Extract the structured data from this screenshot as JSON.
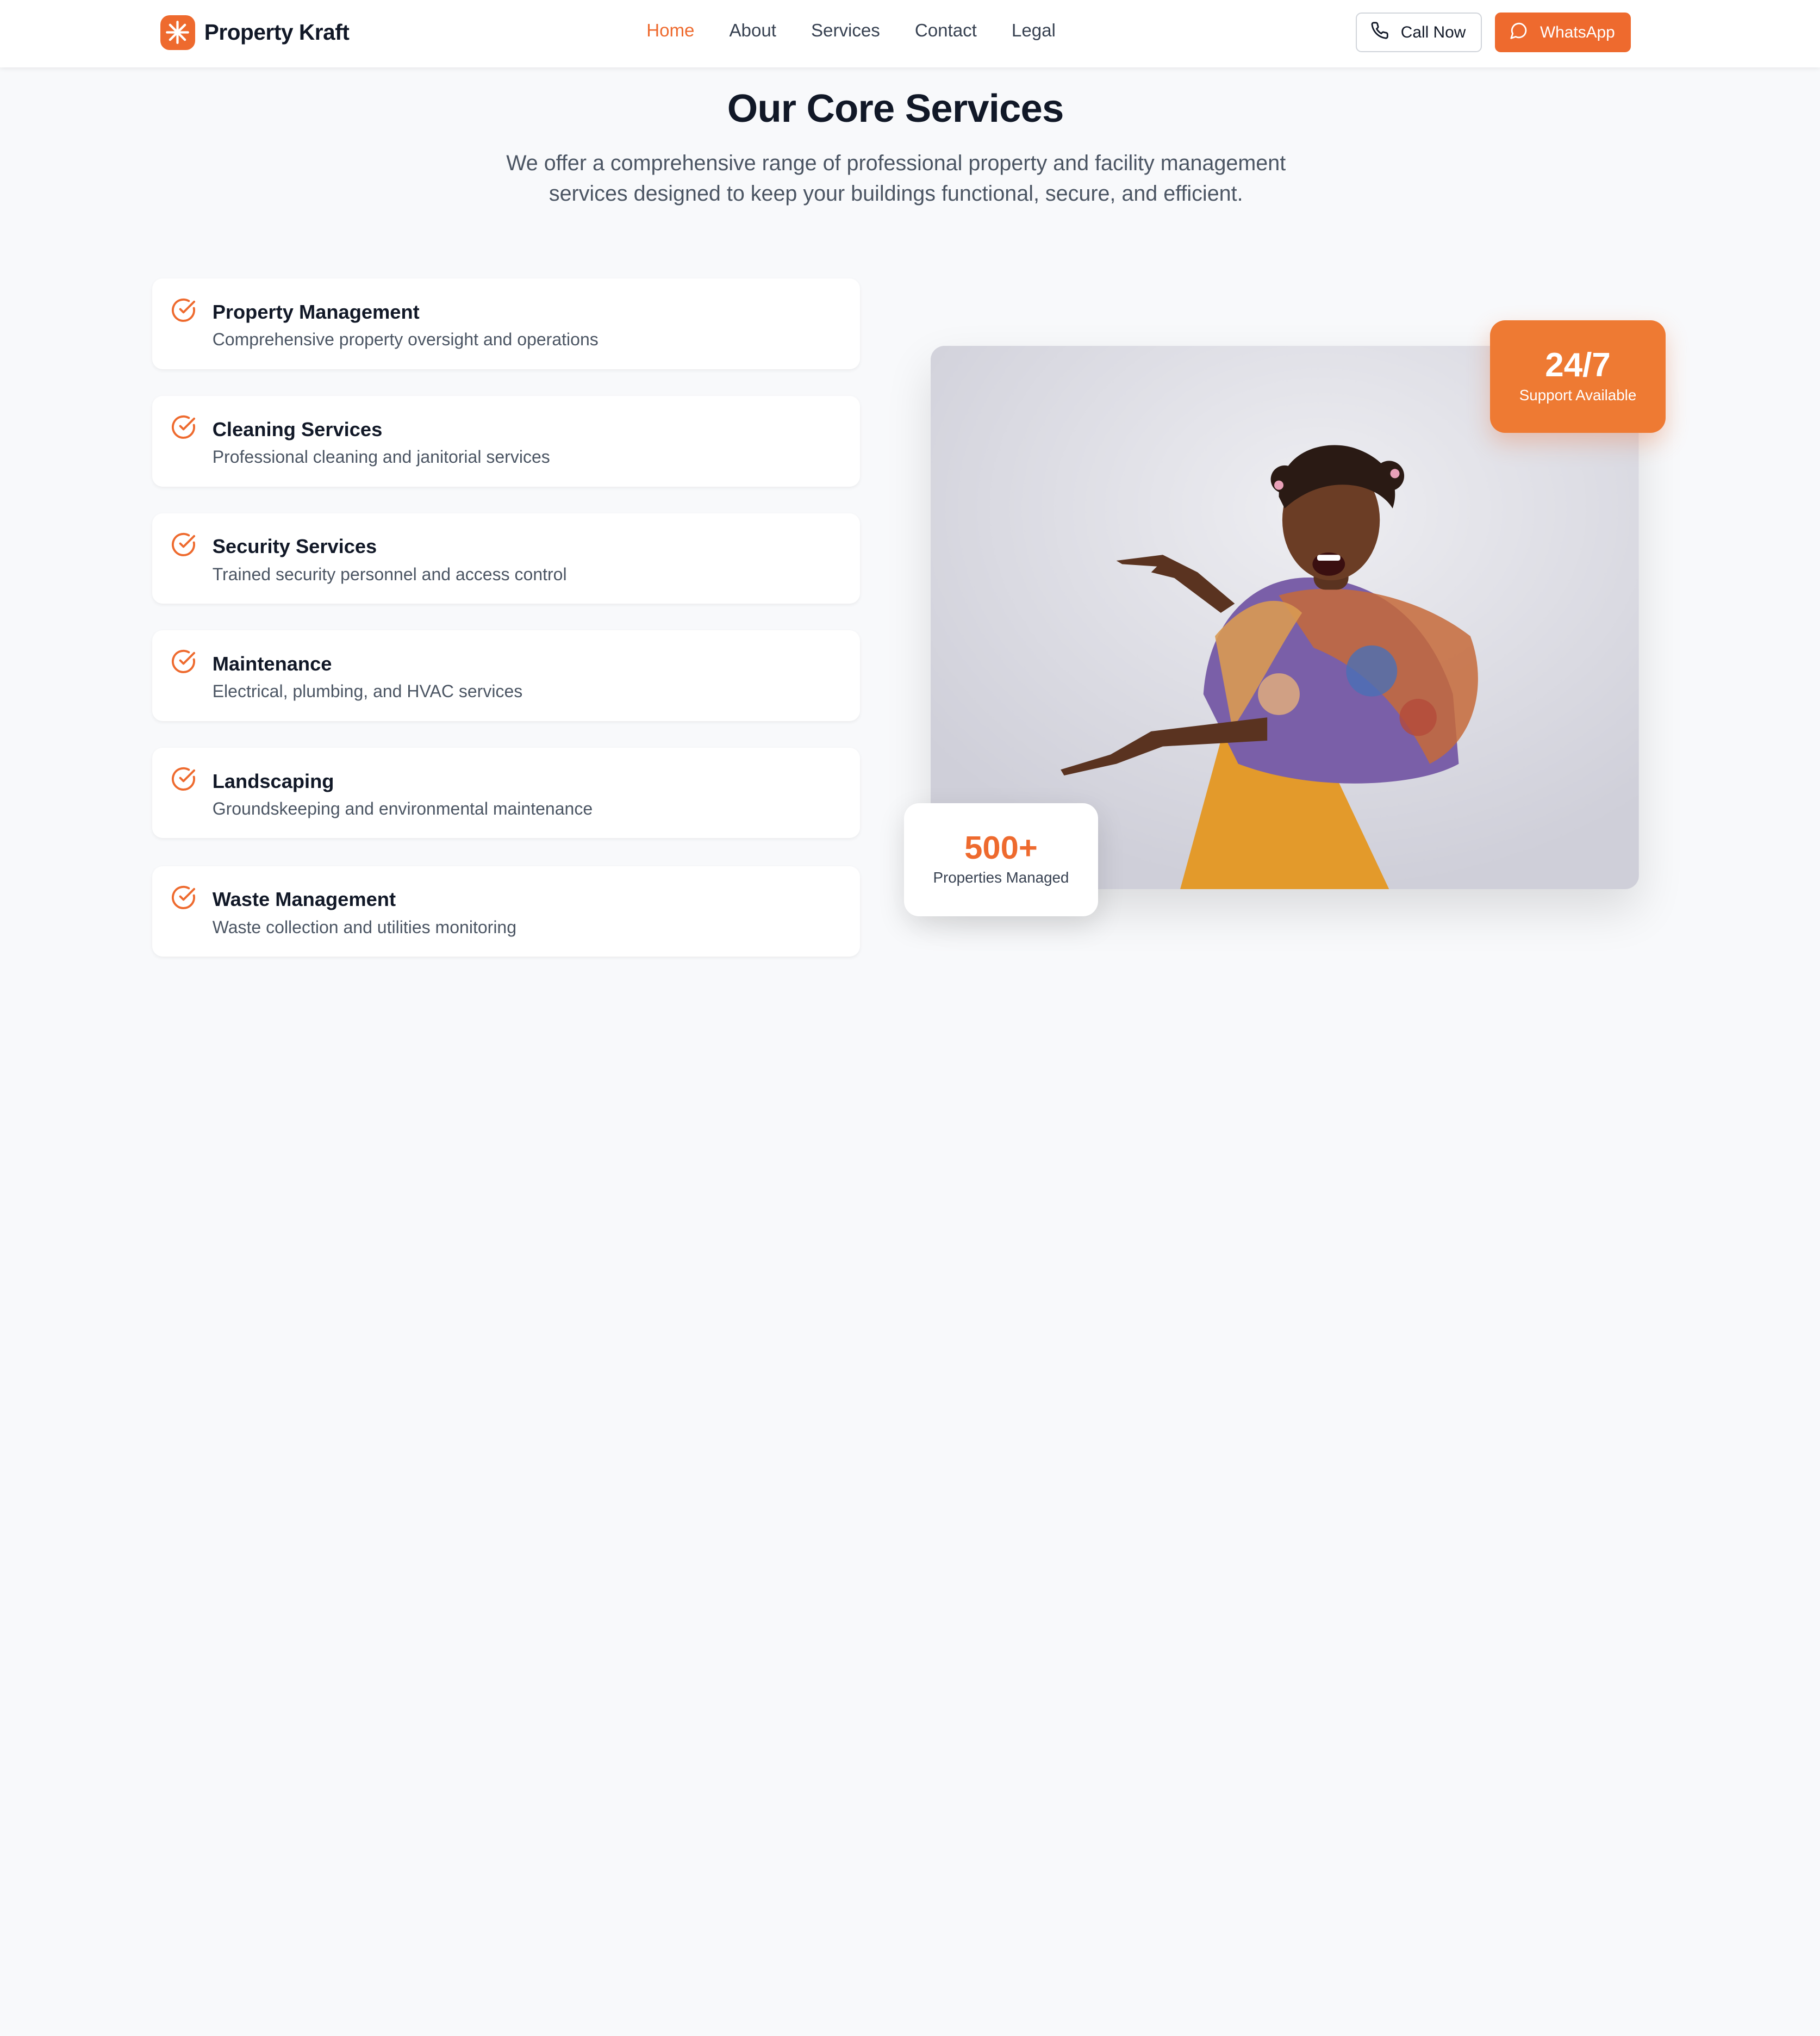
{
  "nav": {
    "brand": "Property Kraft",
    "links": [
      "Home",
      "About",
      "Services",
      "Contact",
      "Legal"
    ],
    "active": "Home",
    "call_label": "Call Now",
    "whatsapp_label": "WhatsApp"
  },
  "header": {
    "title": "Our Core Services",
    "subtitle": "We offer a comprehensive range of professional property and facility management services designed to keep your buildings functional, secure, and efficient."
  },
  "services": [
    {
      "title": "Property Management",
      "desc": "Comprehensive property oversight and operations"
    },
    {
      "title": "Cleaning Services",
      "desc": "Professional cleaning and janitorial services"
    },
    {
      "title": "Security Services",
      "desc": "Trained security personnel and access control"
    },
    {
      "title": "Maintenance",
      "desc": "Electrical, plumbing, and HVAC services"
    },
    {
      "title": "Landscaping",
      "desc": "Groundskeeping and environmental maintenance"
    },
    {
      "title": "Waste Management",
      "desc": "Waste collection and utilities monitoring"
    }
  ],
  "stats": {
    "support": {
      "value": "24/7",
      "label": "Support Available"
    },
    "properties": {
      "value": "500+",
      "label": "Properties Managed"
    }
  },
  "colors": {
    "accent": "#ee6a2e",
    "text": "#111827",
    "muted": "#4b5563",
    "background": "#f8f9fb"
  },
  "icons": {
    "brand": "asterisk-logo-icon",
    "call": "phone-icon",
    "whatsapp": "chat-bubble-icon",
    "service": "check-circle-icon"
  }
}
